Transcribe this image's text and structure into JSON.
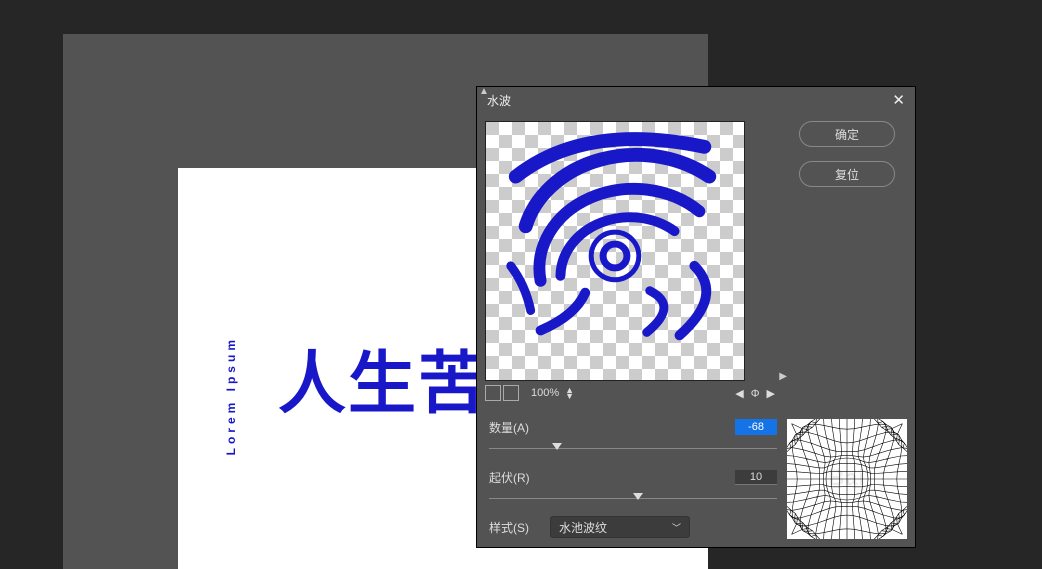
{
  "page": {
    "main_text": "人生苦",
    "side_text": "Lorem Ipsum"
  },
  "dialog": {
    "title": "水波",
    "buttons": {
      "ok": "确定",
      "reset": "复位"
    },
    "zoom": "100%",
    "amount": {
      "label": "数量(A)",
      "value": "-68"
    },
    "ridges": {
      "label": "起伏(R)",
      "value": "10"
    },
    "style": {
      "label": "样式(S)",
      "value": "水池波纹"
    }
  }
}
